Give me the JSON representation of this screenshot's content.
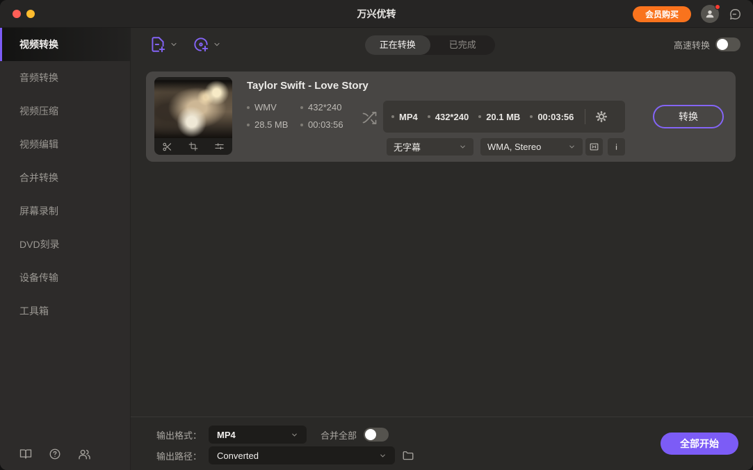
{
  "titlebar": {
    "title": "万兴优转",
    "buy_button": "会员购买"
  },
  "sidebar": {
    "items": [
      {
        "label": "视频转换",
        "active": true
      },
      {
        "label": "音频转换",
        "active": false
      },
      {
        "label": "视频压缩",
        "active": false
      },
      {
        "label": "视频编辑",
        "active": false
      },
      {
        "label": "合并转换",
        "active": false
      },
      {
        "label": "屏幕录制",
        "active": false
      },
      {
        "label": "DVD刻录",
        "active": false
      },
      {
        "label": "设备传输",
        "active": false
      },
      {
        "label": "工具箱",
        "active": false
      }
    ]
  },
  "toolbar": {
    "tabs": [
      {
        "label": "正在转换",
        "active": true
      },
      {
        "label": "已完成",
        "active": false
      }
    ],
    "high_speed_label": "高速转换",
    "high_speed_on": false
  },
  "task": {
    "title": "Taylor Swift - Love Story",
    "source": {
      "format": "WMV",
      "resolution": "432*240",
      "size": "28.5 MB",
      "duration": "00:03:56"
    },
    "output": {
      "format": "MP4",
      "resolution": "432*240",
      "size": "20.1 MB",
      "duration": "00:03:56"
    },
    "subtitle_dropdown": "无字幕",
    "audio_dropdown": "WMA, Stereo",
    "convert_button": "转换"
  },
  "footer": {
    "output_format_label": "输出格式：",
    "output_format_value": "MP4",
    "merge_label": "合并全部",
    "merge_on": false,
    "output_path_label": "输出路径：",
    "output_path_value": "Converted",
    "start_all_button": "全部开始"
  },
  "colors": {
    "accent_purple": "#7c5cf6",
    "buy_orange": "#f9731d",
    "notification_red": "#ff3b30",
    "traffic_red": "#ff5f57",
    "traffic_yellow": "#febc2e",
    "card_bg": "#484644",
    "panel_bg": "#2b2a28"
  },
  "icons": {
    "close": "red-circle",
    "minimize": "yellow-circle",
    "avatar": "person-silhouette",
    "feedback": "chat-bubble",
    "add_file": "document-plus",
    "add_dvd": "disc-plus",
    "chevron_down": "v",
    "trim": "scissors",
    "crop": "crop-frame",
    "effects": "sliders",
    "convert_direction": "shuffle-arrows",
    "settings": "gear",
    "resize": "bracket-arrows",
    "info": "i",
    "folder": "folder",
    "guide": "open-book",
    "help": "question-circle",
    "community": "users"
  }
}
